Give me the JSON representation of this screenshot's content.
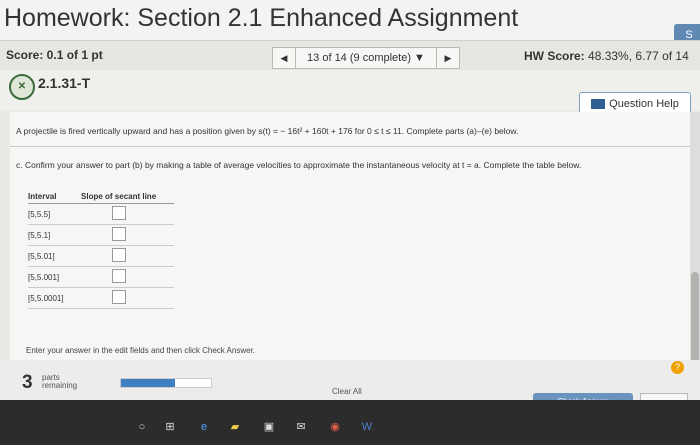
{
  "header": {
    "title": "Homework: Section 2.1 Enhanced Assignment",
    "corner": "S"
  },
  "score_row": {
    "score": "Score: 0.1 of 1 pt",
    "nav_label": "13 of 14 (9 complete)",
    "hw_score_label": "HW Score:",
    "hw_score_value": "48.33%, 6.77 of 14"
  },
  "question": {
    "id": "2.1.31-T",
    "help_label": "Question Help",
    "problem": "A projectile is fired vertically upward and has a position given by s(t) = − 16t² + 160t + 176 for 0 ≤ t ≤ 11. Complete parts (a)–(e) below.",
    "part_c": "c. Confirm your answer to part (b) by making a table of average velocities to approximate the instantaneous velocity at t = a. Complete the table below."
  },
  "table": {
    "headers": [
      "Interval",
      "Slope of secant line"
    ],
    "rows": [
      "[5,5.5]",
      "[5,5.1]",
      "[5,5.01]",
      "[5,5.001]",
      "[5,5.0001]"
    ]
  },
  "instructions": "Enter your answer in the edit fields and then click Check Answer.",
  "footer": {
    "parts_num": "3",
    "parts_line1": "parts",
    "parts_line2": "remaining",
    "progress": 0.6,
    "clear_all": "Clear All",
    "check_answer": "Check Answer",
    "help": "?"
  }
}
